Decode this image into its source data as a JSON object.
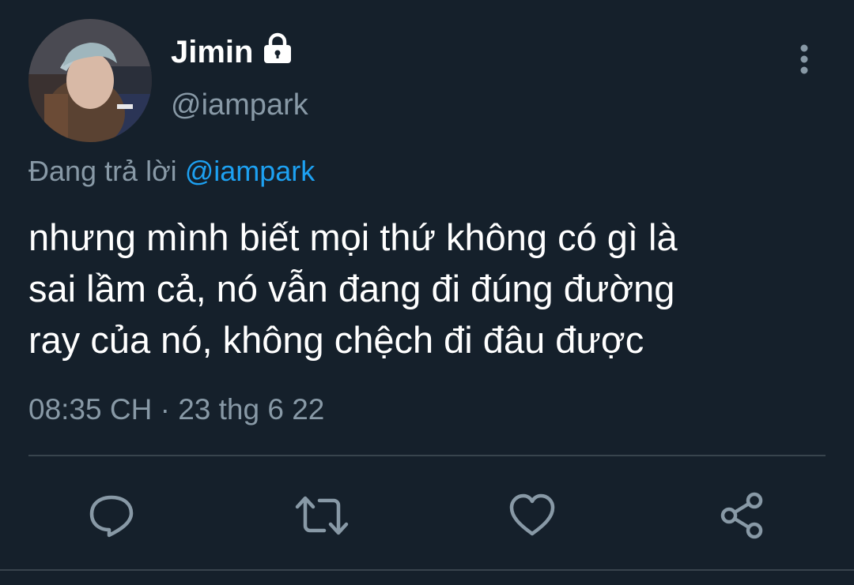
{
  "tweet": {
    "author": {
      "display_name": "Jimin",
      "handle": "@iampark",
      "avatar": "profile-photo",
      "protected_icon": "lock-icon"
    },
    "reply_to": {
      "prefix": "Đang trả lời",
      "mention": "@iampark"
    },
    "text": "nhưng mình biết mọi thứ không có gì là\nsai lầm cả, nó vẫn đang đi đúng đường\nray của nó, không chệch đi đâu được",
    "timestamp": "08:35 CH · 23 thg 6 22",
    "menu_icon": "more-vertical-icon"
  },
  "actions": {
    "reply_icon": "reply-icon",
    "retweet_icon": "retweet-icon",
    "like_icon": "heart-icon",
    "share_icon": "share-icon"
  },
  "colors": {
    "background": "#15202b",
    "primary_text": "#ffffff",
    "secondary_text": "#8899a6",
    "accent": "#1da1f2",
    "divider": "#38444d"
  }
}
